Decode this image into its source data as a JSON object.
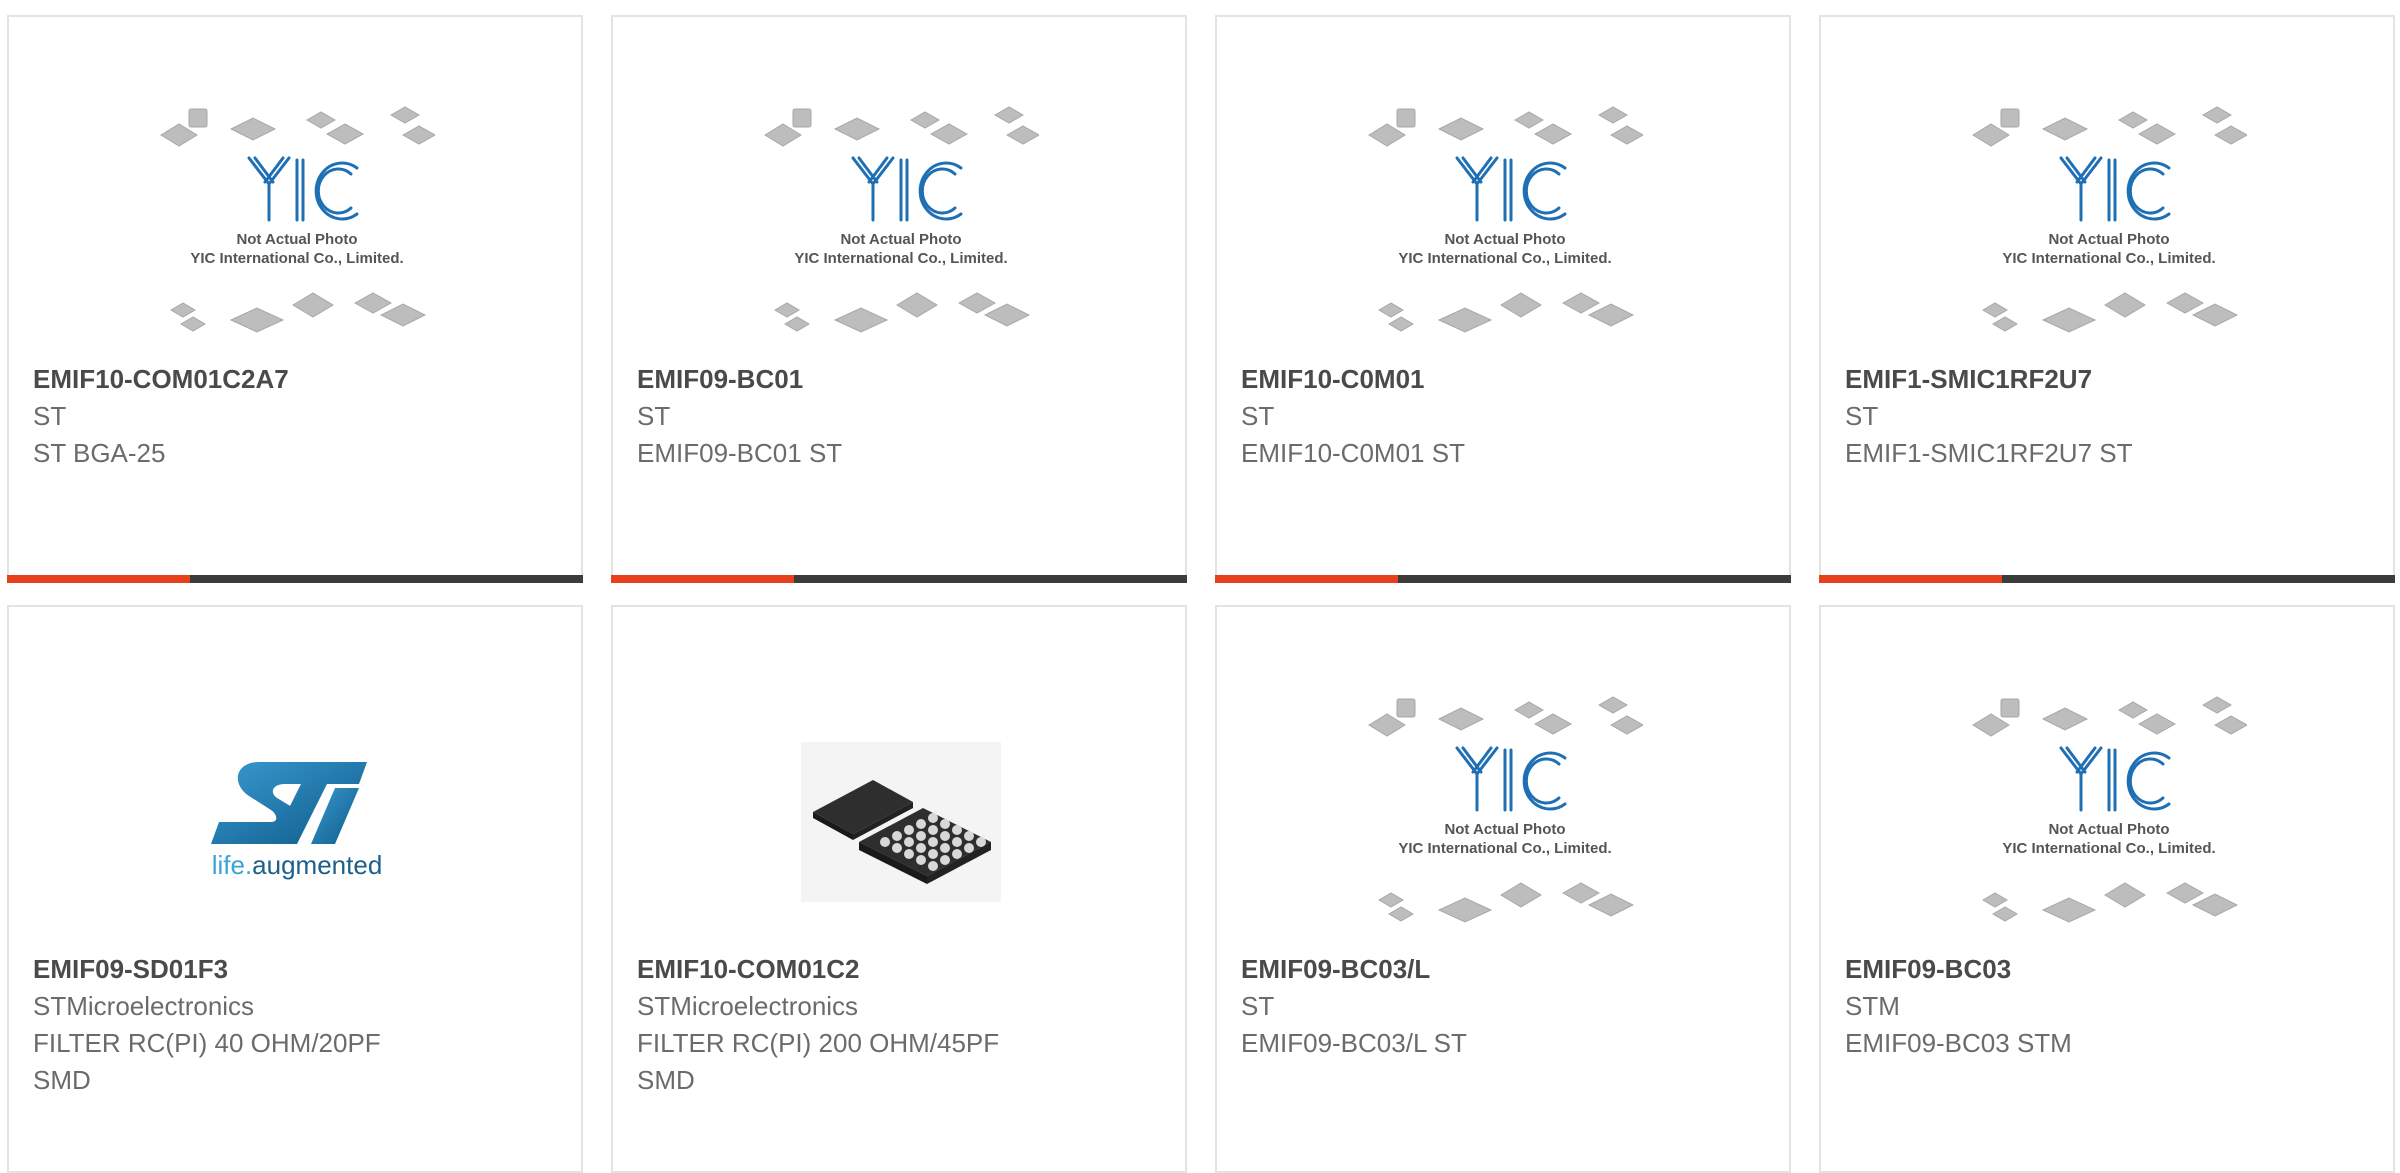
{
  "accent_color": "#e8401c",
  "placeholder": {
    "logo_text": "YIC",
    "caption_line1": "Not Actual Photo",
    "caption_line2": "YIC International Co., Limited."
  },
  "st_logo": {
    "tagline_part1": "life.",
    "tagline_part2": "augmented"
  },
  "products": [
    {
      "part": "EMIF10-COM01C2A7",
      "manufacturer": "ST",
      "desc1": "ST BGA-25",
      "desc2": "",
      "image": "placeholder"
    },
    {
      "part": "EMIF09-BC01",
      "manufacturer": "ST",
      "desc1": "EMIF09-BC01 ST",
      "desc2": "",
      "image": "placeholder"
    },
    {
      "part": "EMIF10-C0M01",
      "manufacturer": "ST",
      "desc1": "EMIF10-C0M01 ST",
      "desc2": "",
      "image": "placeholder"
    },
    {
      "part": "EMIF1-SMIC1RF2U7",
      "manufacturer": "ST",
      "desc1": "EMIF1-SMIC1RF2U7 ST",
      "desc2": "",
      "image": "placeholder"
    },
    {
      "part": "EMIF09-SD01F3",
      "manufacturer": "STMicroelectronics",
      "desc1": "FILTER RC(PI) 40 OHM/20PF",
      "desc2": "SMD",
      "image": "st-logo"
    },
    {
      "part": "EMIF10-COM01C2",
      "manufacturer": "STMicroelectronics",
      "desc1": "FILTER RC(PI) 200 OHM/45PF",
      "desc2": "SMD",
      "image": "bga-chip"
    },
    {
      "part": "EMIF09-BC03/L",
      "manufacturer": "ST",
      "desc1": "EMIF09-BC03/L ST",
      "desc2": "",
      "image": "placeholder"
    },
    {
      "part": "EMIF09-BC03",
      "manufacturer": "STM",
      "desc1": "EMIF09-BC03 STM",
      "desc2": "",
      "image": "placeholder"
    }
  ]
}
